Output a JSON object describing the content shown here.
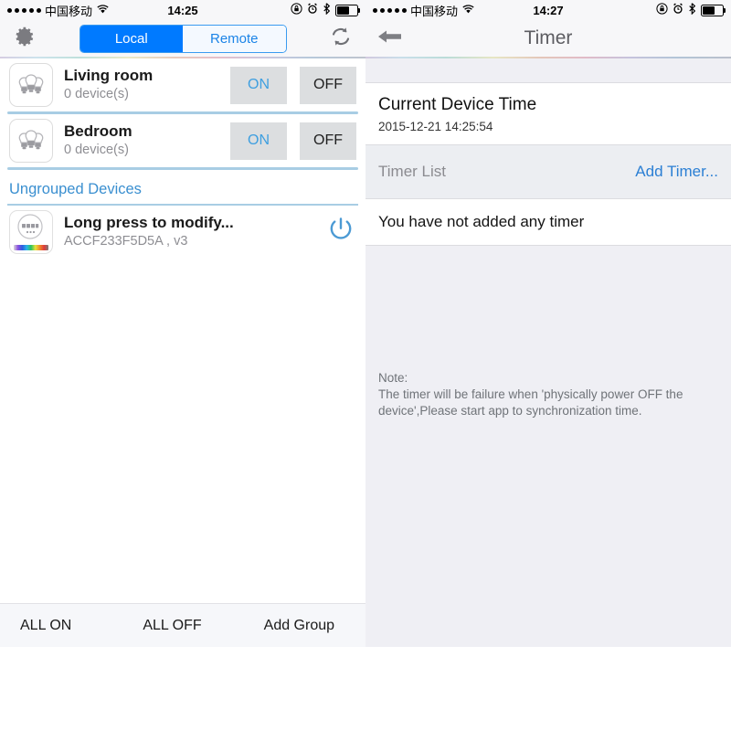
{
  "left": {
    "status_bar": {
      "signal_dots": 5,
      "carrier": "中国移动",
      "wifi_icon": "wifi-icon",
      "time": "14:25",
      "rotation_lock_icon": "rotation-lock-icon",
      "alarm_icon": "alarm-clock-icon",
      "bluetooth_icon": "bluetooth-icon",
      "battery_icon": "battery-icon"
    },
    "navbar": {
      "settings_icon": "gear-icon",
      "refresh_icon": "refresh-icon",
      "segment_local": "Local",
      "segment_remote": "Remote",
      "selected_segment": "Local"
    },
    "groups": [
      {
        "name": "Living room",
        "count": "0 device(s)",
        "on": "ON",
        "off": "OFF",
        "icon": "bulbs-icon"
      },
      {
        "name": "Bedroom",
        "count": "0 device(s)",
        "on": "ON",
        "off": "OFF",
        "icon": "bulbs-icon"
      }
    ],
    "ungrouped_header": "Ungrouped Devices",
    "devices": [
      {
        "name": "Long press to modify...",
        "mac": "ACCF233F5D5A , v3",
        "power_icon": "power-icon",
        "icon": "rgb-bulb-icon"
      }
    ],
    "toolbar": {
      "all_on": "ALL ON",
      "all_off": "ALL OFF",
      "add_group": "Add Group"
    }
  },
  "right": {
    "status_bar": {
      "signal_dots": 5,
      "carrier": "中国移动",
      "wifi_icon": "wifi-icon",
      "time": "14:27",
      "rotation_lock_icon": "rotation-lock-icon",
      "alarm_icon": "alarm-clock-icon",
      "bluetooth_icon": "bluetooth-icon",
      "battery_icon": "battery-icon"
    },
    "navbar": {
      "back_icon": "back-arrow-icon",
      "title": "Timer"
    },
    "current_time": {
      "label": "Current Device Time",
      "value": "2015-12-21 14:25:54"
    },
    "timer_list": {
      "label": "Timer List",
      "add_label": "Add Timer...",
      "empty_text": "You have not added any timer"
    },
    "note": {
      "heading": "Note:",
      "line1": "The timer will be failure when 'physically power OFF the",
      "line2": "device',Please start app to synchronization time."
    }
  },
  "colors": {
    "accent_blue": "#007aff",
    "link_blue": "#2b7fd4",
    "separator_blue": "#a8cde4",
    "panel_gray": "#efeff4",
    "button_gray": "#dcdee0"
  }
}
